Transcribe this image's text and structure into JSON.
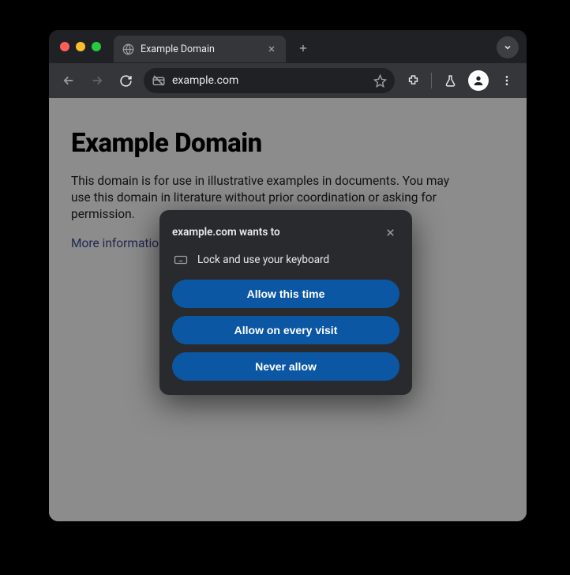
{
  "tab": {
    "title": "Example Domain"
  },
  "address_bar": {
    "url": "example.com"
  },
  "page": {
    "heading": "Example Domain",
    "paragraph": "This domain is for use in illustrative examples in documents. You may use this domain in literature without prior coordination or asking for permission.",
    "link_text": "More information..."
  },
  "permission_dialog": {
    "title": "example.com wants to",
    "request": "Lock and use your keyboard",
    "buttons": {
      "allow_once": "Allow this time",
      "allow_always": "Allow on every visit",
      "deny": "Never allow"
    }
  }
}
